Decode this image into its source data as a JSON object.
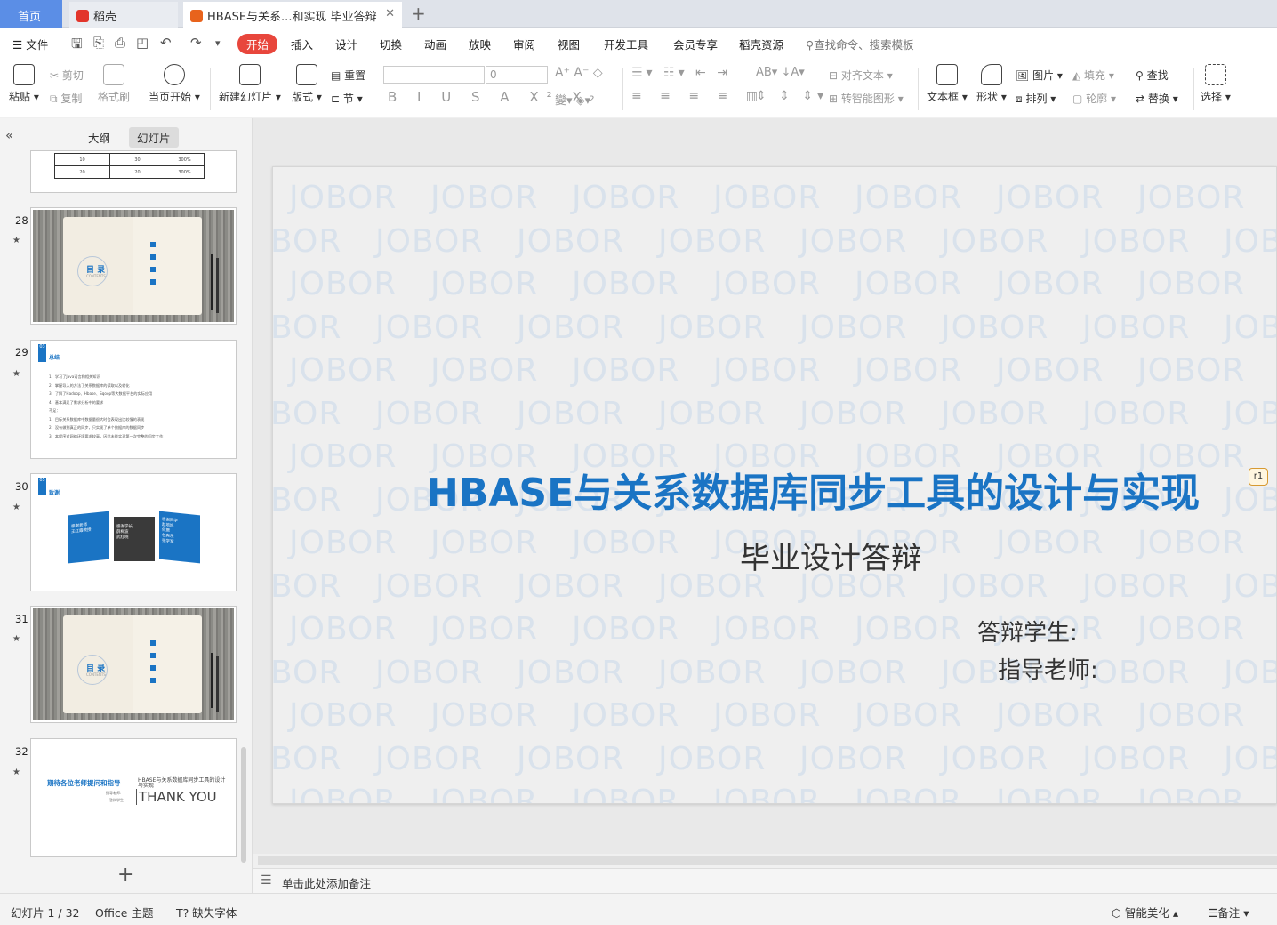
{
  "tabs": {
    "home": "首页",
    "docer": "稻壳",
    "document": "HBASE与关系...和实现 毕业答辩"
  },
  "menu": {
    "file": "文件",
    "items": [
      "开始",
      "插入",
      "设计",
      "切换",
      "动画",
      "放映",
      "审阅",
      "视图",
      "开发工具",
      "会员专享",
      "稻壳资源"
    ],
    "search": "查找命令、搜索模板"
  },
  "ribbon": {
    "paste": "粘贴",
    "cut": "剪切",
    "copy": "复制",
    "format_painter": "格式刷",
    "play_from_current": "当页开始",
    "new_slide": "新建幻灯片",
    "layout": "版式",
    "reset": "重置",
    "section": "节",
    "font_size": "0",
    "align_text": "对齐文本",
    "smart_shape": "转智能图形",
    "textbox": "文本框",
    "shape": "形状",
    "picture": "图片",
    "fill": "填充",
    "arrange": "排列",
    "outline": "轮廓",
    "find": "查找",
    "replace": "替换",
    "select": "选择"
  },
  "left_panel": {
    "tab_outline": "大纲",
    "tab_slides": "幻灯片",
    "table_cells": [
      [
        "10",
        "30",
        "300%"
      ],
      [
        "20",
        "20",
        "300%"
      ]
    ],
    "slides": [
      {
        "num": "28",
        "kind": "toc",
        "toc_title": "目 录",
        "toc_sub": "CONTENTS"
      },
      {
        "num": "29",
        "kind": "summary",
        "badge": "03",
        "heading": "总结",
        "lines": [
          "1、学习了Java语言和相关知识",
          "2、掌握导入的方法了关系数据库的读取以及转化",
          "3、了解了Hadoop、Hbase、Sqoop等大数据平台的实际应用",
          "4、基本满足了需求分析中的要求",
          "不足：",
          "1、目标关系数据库中数据量很大时会表现出比较慢的表现",
          "2、没有做到真正的同步，只实现了单个数据库的数据同步",
          "3、本程序对网络环境要求较高，因此未能实现第一次完整的同步工作"
        ]
      },
      {
        "num": "30",
        "kind": "thanks",
        "badge": "05",
        "heading": "致谢",
        "boxes": [
          {
            "title": "感谢老师",
            "items": [
              "王红霞教授"
            ]
          },
          {
            "title": "感谢学长",
            "items": [
              "薛梅波",
              "武红晓"
            ]
          },
          {
            "title": "感谢同学",
            "items": [
              "赵培旭",
              "何原",
              "包爽乐",
              "张学军"
            ]
          }
        ]
      },
      {
        "num": "31",
        "kind": "toc",
        "toc_title": "目 录",
        "toc_sub": "CONTENTS"
      },
      {
        "num": "32",
        "kind": "end",
        "left_text": "期待各位老师提问和指导",
        "small1": "指导老师:",
        "small2": "答辩学生:",
        "right_small": "HBASE与关系数据库同步工具的设计与实现",
        "thank": "THANK YOU"
      }
    ]
  },
  "slide": {
    "watermark": "JOBOR",
    "title": "HBASE与关系数据库同步工具的设计与实现",
    "subtitle": "毕业设计答辩",
    "student_label": "答辩学生:",
    "teacher_label": "指导老师:",
    "comment_tag": "r1"
  },
  "notes_placeholder": "单击此处添加备注",
  "status": {
    "slide_counter": "幻灯片 1 / 32",
    "theme": "Office 主题",
    "missing_font": "缺失字体",
    "smart_beautify": "智能美化",
    "notes": "备注"
  },
  "colors": {
    "accent_red": "#e8463c",
    "title_blue": "#1a74c4",
    "home_tab": "#5b8ee6"
  }
}
